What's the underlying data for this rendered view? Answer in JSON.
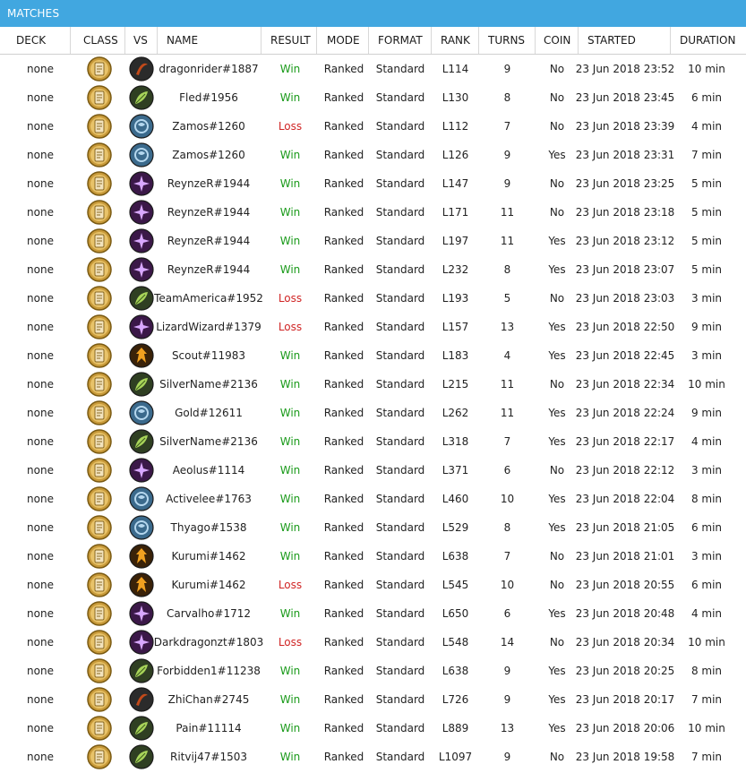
{
  "window": {
    "title": "MATCHES"
  },
  "columns": [
    "DECK",
    "CLASS",
    "VS",
    "NAME",
    "RESULT",
    "MODE",
    "FORMAT",
    "RANK",
    "TURNS",
    "COIN",
    "STARTED",
    "DURATION"
  ],
  "colors": {
    "titlebar": "#41a7e0",
    "win": "#1a9a1a",
    "loss": "#d02525"
  },
  "hero_icons": {
    "warrior": {
      "name": "warrior-icon",
      "bg": "#2b2b2b",
      "fg": "#c24a1a"
    },
    "druid": {
      "name": "druid-icon",
      "bg": "#2f3f22",
      "fg": "#a8d45a"
    },
    "shaman": {
      "name": "shaman-icon",
      "bg": "#3b6a8c",
      "fg": "#b5d7ee"
    },
    "warlock": {
      "name": "warlock-icon",
      "bg": "#3b1848",
      "fg": "#d9a8ff"
    },
    "hunter": {
      "name": "hunter-icon",
      "bg": "#3a2208",
      "fg": "#f0a020"
    },
    "class": {
      "name": "class-card-icon",
      "bg": "#c89a3a",
      "fg": "#f2e3bd"
    }
  },
  "matches": [
    {
      "deck": "none",
      "vs": "warrior",
      "name": "dragonrider#1887",
      "result": "Win",
      "mode": "Ranked",
      "format": "Standard",
      "rank": "L114",
      "turns": "9",
      "coin": "No",
      "started": "23 Jun 2018 23:52",
      "duration": "10 min"
    },
    {
      "deck": "none",
      "vs": "druid",
      "name": "Fled#1956",
      "result": "Win",
      "mode": "Ranked",
      "format": "Standard",
      "rank": "L130",
      "turns": "8",
      "coin": "No",
      "started": "23 Jun 2018 23:45",
      "duration": "6 min"
    },
    {
      "deck": "none",
      "vs": "shaman",
      "name": "Zamos#1260",
      "result": "Loss",
      "mode": "Ranked",
      "format": "Standard",
      "rank": "L112",
      "turns": "7",
      "coin": "No",
      "started": "23 Jun 2018 23:39",
      "duration": "4 min"
    },
    {
      "deck": "none",
      "vs": "shaman",
      "name": "Zamos#1260",
      "result": "Win",
      "mode": "Ranked",
      "format": "Standard",
      "rank": "L126",
      "turns": "9",
      "coin": "Yes",
      "started": "23 Jun 2018 23:31",
      "duration": "7 min"
    },
    {
      "deck": "none",
      "vs": "warlock",
      "name": "ReynzeR#1944",
      "result": "Win",
      "mode": "Ranked",
      "format": "Standard",
      "rank": "L147",
      "turns": "9",
      "coin": "No",
      "started": "23 Jun 2018 23:25",
      "duration": "5 min"
    },
    {
      "deck": "none",
      "vs": "warlock",
      "name": "ReynzeR#1944",
      "result": "Win",
      "mode": "Ranked",
      "format": "Standard",
      "rank": "L171",
      "turns": "11",
      "coin": "No",
      "started": "23 Jun 2018 23:18",
      "duration": "5 min"
    },
    {
      "deck": "none",
      "vs": "warlock",
      "name": "ReynzeR#1944",
      "result": "Win",
      "mode": "Ranked",
      "format": "Standard",
      "rank": "L197",
      "turns": "11",
      "coin": "Yes",
      "started": "23 Jun 2018 23:12",
      "duration": "5 min"
    },
    {
      "deck": "none",
      "vs": "warlock",
      "name": "ReynzeR#1944",
      "result": "Win",
      "mode": "Ranked",
      "format": "Standard",
      "rank": "L232",
      "turns": "8",
      "coin": "Yes",
      "started": "23 Jun 2018 23:07",
      "duration": "5 min"
    },
    {
      "deck": "none",
      "vs": "druid",
      "name": "TeamAmerica#1952",
      "result": "Loss",
      "mode": "Ranked",
      "format": "Standard",
      "rank": "L193",
      "turns": "5",
      "coin": "No",
      "started": "23 Jun 2018 23:03",
      "duration": "3 min"
    },
    {
      "deck": "none",
      "vs": "warlock",
      "name": "LizardWizard#1379",
      "result": "Loss",
      "mode": "Ranked",
      "format": "Standard",
      "rank": "L157",
      "turns": "13",
      "coin": "Yes",
      "started": "23 Jun 2018 22:50",
      "duration": "9 min"
    },
    {
      "deck": "none",
      "vs": "hunter",
      "name": "Scout#11983",
      "result": "Win",
      "mode": "Ranked",
      "format": "Standard",
      "rank": "L183",
      "turns": "4",
      "coin": "Yes",
      "started": "23 Jun 2018 22:45",
      "duration": "3 min"
    },
    {
      "deck": "none",
      "vs": "druid",
      "name": "SilverName#2136",
      "result": "Win",
      "mode": "Ranked",
      "format": "Standard",
      "rank": "L215",
      "turns": "11",
      "coin": "No",
      "started": "23 Jun 2018 22:34",
      "duration": "10 min"
    },
    {
      "deck": "none",
      "vs": "shaman",
      "name": "Gold#12611",
      "result": "Win",
      "mode": "Ranked",
      "format": "Standard",
      "rank": "L262",
      "turns": "11",
      "coin": "Yes",
      "started": "23 Jun 2018 22:24",
      "duration": "9 min"
    },
    {
      "deck": "none",
      "vs": "druid",
      "name": "SilverName#2136",
      "result": "Win",
      "mode": "Ranked",
      "format": "Standard",
      "rank": "L318",
      "turns": "7",
      "coin": "Yes",
      "started": "23 Jun 2018 22:17",
      "duration": "4 min"
    },
    {
      "deck": "none",
      "vs": "warlock",
      "name": "Aeolus#1114",
      "result": "Win",
      "mode": "Ranked",
      "format": "Standard",
      "rank": "L371",
      "turns": "6",
      "coin": "No",
      "started": "23 Jun 2018 22:12",
      "duration": "3 min"
    },
    {
      "deck": "none",
      "vs": "shaman",
      "name": "Activelee#1763",
      "result": "Win",
      "mode": "Ranked",
      "format": "Standard",
      "rank": "L460",
      "turns": "10",
      "coin": "Yes",
      "started": "23 Jun 2018 22:04",
      "duration": "8 min"
    },
    {
      "deck": "none",
      "vs": "shaman",
      "name": "Thyago#1538",
      "result": "Win",
      "mode": "Ranked",
      "format": "Standard",
      "rank": "L529",
      "turns": "8",
      "coin": "Yes",
      "started": "23 Jun 2018 21:05",
      "duration": "6 min"
    },
    {
      "deck": "none",
      "vs": "hunter",
      "name": "Kurumi#1462",
      "result": "Win",
      "mode": "Ranked",
      "format": "Standard",
      "rank": "L638",
      "turns": "7",
      "coin": "No",
      "started": "23 Jun 2018 21:01",
      "duration": "3 min"
    },
    {
      "deck": "none",
      "vs": "hunter",
      "name": "Kurumi#1462",
      "result": "Loss",
      "mode": "Ranked",
      "format": "Standard",
      "rank": "L545",
      "turns": "10",
      "coin": "No",
      "started": "23 Jun 2018 20:55",
      "duration": "6 min"
    },
    {
      "deck": "none",
      "vs": "warlock",
      "name": "Carvalho#1712",
      "result": "Win",
      "mode": "Ranked",
      "format": "Standard",
      "rank": "L650",
      "turns": "6",
      "coin": "Yes",
      "started": "23 Jun 2018 20:48",
      "duration": "4 min"
    },
    {
      "deck": "none",
      "vs": "warlock",
      "name": "Darkdragonzt#1803",
      "result": "Loss",
      "mode": "Ranked",
      "format": "Standard",
      "rank": "L548",
      "turns": "14",
      "coin": "No",
      "started": "23 Jun 2018 20:34",
      "duration": "10 min"
    },
    {
      "deck": "none",
      "vs": "druid",
      "name": "Forbidden1#11238",
      "result": "Win",
      "mode": "Ranked",
      "format": "Standard",
      "rank": "L638",
      "turns": "9",
      "coin": "Yes",
      "started": "23 Jun 2018 20:25",
      "duration": "8 min"
    },
    {
      "deck": "none",
      "vs": "warrior",
      "name": "ZhiChan#2745",
      "result": "Win",
      "mode": "Ranked",
      "format": "Standard",
      "rank": "L726",
      "turns": "9",
      "coin": "Yes",
      "started": "23 Jun 2018 20:17",
      "duration": "7 min"
    },
    {
      "deck": "none",
      "vs": "druid",
      "name": "Pain#11114",
      "result": "Win",
      "mode": "Ranked",
      "format": "Standard",
      "rank": "L889",
      "turns": "13",
      "coin": "Yes",
      "started": "23 Jun 2018 20:06",
      "duration": "10 min"
    },
    {
      "deck": "none",
      "vs": "druid",
      "name": "Ritvij47#1503",
      "result": "Win",
      "mode": "Ranked",
      "format": "Standard",
      "rank": "L1097",
      "turns": "9",
      "coin": "No",
      "started": "23 Jun 2018 19:58",
      "duration": "7 min"
    }
  ]
}
